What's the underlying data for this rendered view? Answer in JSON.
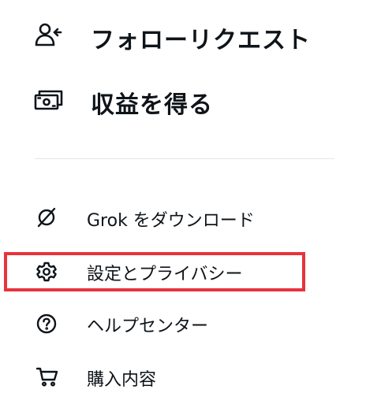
{
  "menu": {
    "primary": [
      {
        "label": "フォローリクエスト",
        "icon": "person-plus-icon"
      },
      {
        "label": "収益を得る",
        "icon": "money-icon"
      }
    ],
    "secondary": [
      {
        "label": "Grok をダウンロード",
        "icon": "grok-icon"
      },
      {
        "label": "設定とプライバシー",
        "icon": "gear-icon"
      },
      {
        "label": "ヘルプセンター",
        "icon": "question-circle-icon"
      },
      {
        "label": "購入内容",
        "icon": "cart-icon"
      }
    ]
  },
  "highlight_color": "#e8333a"
}
